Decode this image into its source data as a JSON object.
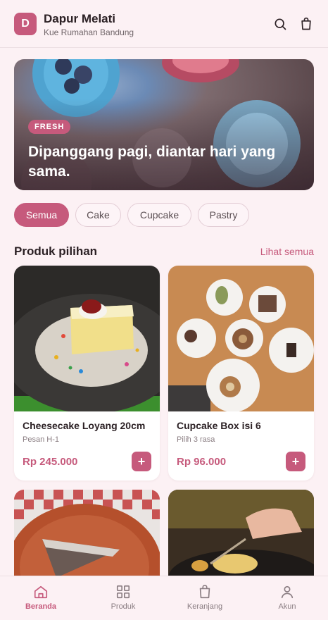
{
  "header": {
    "logo_letter": "D",
    "store_name": "Dapur Melati",
    "store_subtitle": "Kue Rumahan Bandung",
    "search_icon": "search-icon",
    "bag_icon": "shopping-bag-icon"
  },
  "hero": {
    "badge": "FRESH",
    "title": "Dipanggang pagi, diantar hari yang sama."
  },
  "chips": [
    {
      "label": "Semua",
      "active": true
    },
    {
      "label": "Cake",
      "active": false
    },
    {
      "label": "Cupcake",
      "active": false
    },
    {
      "label": "Pastry",
      "active": false
    }
  ],
  "section": {
    "title": "Produk pilihan",
    "see_all": "Lihat semua"
  },
  "products": [
    {
      "name": "Cheesecake Loyang 20cm",
      "note": "Pesan H-1",
      "price": "Rp 245.000",
      "add": "+"
    },
    {
      "name": "Cupcake Box isi 6",
      "note": "Pilih 3 rasa",
      "price": "Rp 96.000",
      "add": "+"
    }
  ],
  "nav": [
    {
      "label": "Beranda",
      "icon": "home-icon",
      "active": true
    },
    {
      "label": "Produk",
      "icon": "grid-icon",
      "active": false
    },
    {
      "label": "Keranjang",
      "icon": "bag-icon",
      "active": false
    },
    {
      "label": "Akun",
      "icon": "user-icon",
      "active": false
    }
  ],
  "colors": {
    "accent": "#c65a7c",
    "background": "#fcf1f4",
    "text": "#2b2024"
  }
}
